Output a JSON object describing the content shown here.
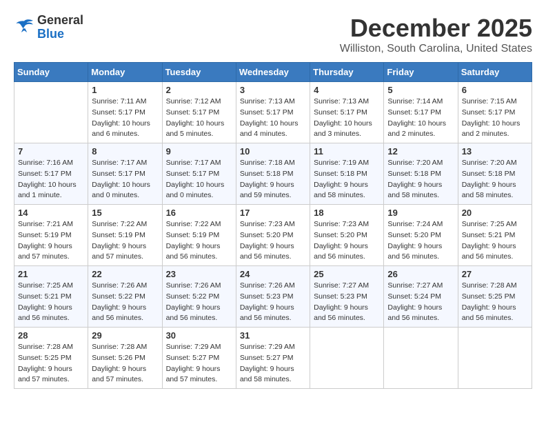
{
  "header": {
    "logo": {
      "line1": "General",
      "line2": "Blue"
    },
    "title": "December 2025",
    "location": "Williston, South Carolina, United States"
  },
  "days_of_week": [
    "Sunday",
    "Monday",
    "Tuesday",
    "Wednesday",
    "Thursday",
    "Friday",
    "Saturday"
  ],
  "weeks": [
    [
      {
        "day": "",
        "info": ""
      },
      {
        "day": "1",
        "info": "Sunrise: 7:11 AM\nSunset: 5:17 PM\nDaylight: 10 hours\nand 6 minutes."
      },
      {
        "day": "2",
        "info": "Sunrise: 7:12 AM\nSunset: 5:17 PM\nDaylight: 10 hours\nand 5 minutes."
      },
      {
        "day": "3",
        "info": "Sunrise: 7:13 AM\nSunset: 5:17 PM\nDaylight: 10 hours\nand 4 minutes."
      },
      {
        "day": "4",
        "info": "Sunrise: 7:13 AM\nSunset: 5:17 PM\nDaylight: 10 hours\nand 3 minutes."
      },
      {
        "day": "5",
        "info": "Sunrise: 7:14 AM\nSunset: 5:17 PM\nDaylight: 10 hours\nand 2 minutes."
      },
      {
        "day": "6",
        "info": "Sunrise: 7:15 AM\nSunset: 5:17 PM\nDaylight: 10 hours\nand 2 minutes."
      }
    ],
    [
      {
        "day": "7",
        "info": "Sunrise: 7:16 AM\nSunset: 5:17 PM\nDaylight: 10 hours\nand 1 minute."
      },
      {
        "day": "8",
        "info": "Sunrise: 7:17 AM\nSunset: 5:17 PM\nDaylight: 10 hours\nand 0 minutes."
      },
      {
        "day": "9",
        "info": "Sunrise: 7:17 AM\nSunset: 5:17 PM\nDaylight: 10 hours\nand 0 minutes."
      },
      {
        "day": "10",
        "info": "Sunrise: 7:18 AM\nSunset: 5:18 PM\nDaylight: 9 hours\nand 59 minutes."
      },
      {
        "day": "11",
        "info": "Sunrise: 7:19 AM\nSunset: 5:18 PM\nDaylight: 9 hours\nand 58 minutes."
      },
      {
        "day": "12",
        "info": "Sunrise: 7:20 AM\nSunset: 5:18 PM\nDaylight: 9 hours\nand 58 minutes."
      },
      {
        "day": "13",
        "info": "Sunrise: 7:20 AM\nSunset: 5:18 PM\nDaylight: 9 hours\nand 58 minutes."
      }
    ],
    [
      {
        "day": "14",
        "info": "Sunrise: 7:21 AM\nSunset: 5:19 PM\nDaylight: 9 hours\nand 57 minutes."
      },
      {
        "day": "15",
        "info": "Sunrise: 7:22 AM\nSunset: 5:19 PM\nDaylight: 9 hours\nand 57 minutes."
      },
      {
        "day": "16",
        "info": "Sunrise: 7:22 AM\nSunset: 5:19 PM\nDaylight: 9 hours\nand 56 minutes."
      },
      {
        "day": "17",
        "info": "Sunrise: 7:23 AM\nSunset: 5:20 PM\nDaylight: 9 hours\nand 56 minutes."
      },
      {
        "day": "18",
        "info": "Sunrise: 7:23 AM\nSunset: 5:20 PM\nDaylight: 9 hours\nand 56 minutes."
      },
      {
        "day": "19",
        "info": "Sunrise: 7:24 AM\nSunset: 5:20 PM\nDaylight: 9 hours\nand 56 minutes."
      },
      {
        "day": "20",
        "info": "Sunrise: 7:25 AM\nSunset: 5:21 PM\nDaylight: 9 hours\nand 56 minutes."
      }
    ],
    [
      {
        "day": "21",
        "info": "Sunrise: 7:25 AM\nSunset: 5:21 PM\nDaylight: 9 hours\nand 56 minutes."
      },
      {
        "day": "22",
        "info": "Sunrise: 7:26 AM\nSunset: 5:22 PM\nDaylight: 9 hours\nand 56 minutes."
      },
      {
        "day": "23",
        "info": "Sunrise: 7:26 AM\nSunset: 5:22 PM\nDaylight: 9 hours\nand 56 minutes."
      },
      {
        "day": "24",
        "info": "Sunrise: 7:26 AM\nSunset: 5:23 PM\nDaylight: 9 hours\nand 56 minutes."
      },
      {
        "day": "25",
        "info": "Sunrise: 7:27 AM\nSunset: 5:23 PM\nDaylight: 9 hours\nand 56 minutes."
      },
      {
        "day": "26",
        "info": "Sunrise: 7:27 AM\nSunset: 5:24 PM\nDaylight: 9 hours\nand 56 minutes."
      },
      {
        "day": "27",
        "info": "Sunrise: 7:28 AM\nSunset: 5:25 PM\nDaylight: 9 hours\nand 56 minutes."
      }
    ],
    [
      {
        "day": "28",
        "info": "Sunrise: 7:28 AM\nSunset: 5:25 PM\nDaylight: 9 hours\nand 57 minutes."
      },
      {
        "day": "29",
        "info": "Sunrise: 7:28 AM\nSunset: 5:26 PM\nDaylight: 9 hours\nand 57 minutes."
      },
      {
        "day": "30",
        "info": "Sunrise: 7:29 AM\nSunset: 5:27 PM\nDaylight: 9 hours\nand 57 minutes."
      },
      {
        "day": "31",
        "info": "Sunrise: 7:29 AM\nSunset: 5:27 PM\nDaylight: 9 hours\nand 58 minutes."
      },
      {
        "day": "",
        "info": ""
      },
      {
        "day": "",
        "info": ""
      },
      {
        "day": "",
        "info": ""
      }
    ]
  ]
}
